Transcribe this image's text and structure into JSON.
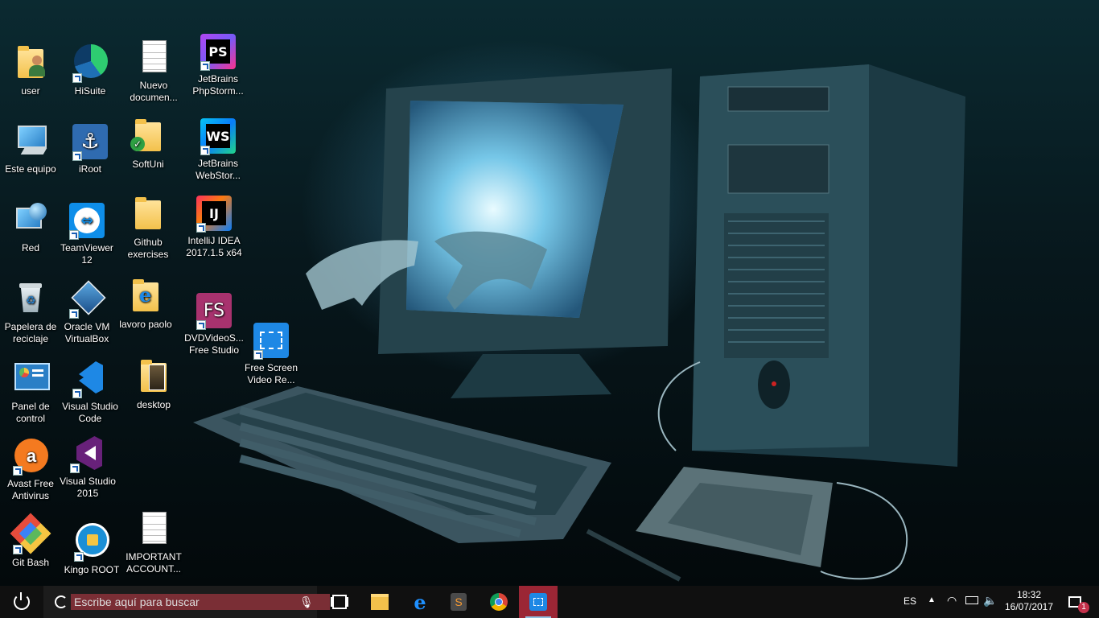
{
  "desktop": {
    "icons": [
      {
        "label": "user",
        "icon": "user-folder-icon"
      },
      {
        "label": "HiSuite",
        "icon": "hisuite-icon"
      },
      {
        "label": "Nuevo documen...",
        "icon": "text-document-icon"
      },
      {
        "label": "JetBrains PhpStorm...",
        "icon": "phpstorm-icon"
      },
      {
        "label": "Este equipo",
        "icon": "computer-icon"
      },
      {
        "label": "iRoot",
        "icon": "iroot-icon"
      },
      {
        "label": "SoftUni",
        "icon": "synced-folder-icon"
      },
      {
        "label": "JetBrains WebStor...",
        "icon": "webstorm-icon"
      },
      {
        "label": "Red",
        "icon": "network-icon"
      },
      {
        "label": "TeamViewer 12",
        "icon": "teamviewer-icon"
      },
      {
        "label": "Github exercises",
        "icon": "folder-icon"
      },
      {
        "label": "IntelliJ IDEA 2017.1.5 x64",
        "icon": "intellij-icon"
      },
      {
        "label": "Papelera de reciclaje",
        "icon": "recycle-bin-icon"
      },
      {
        "label": "Oracle VM VirtualBox",
        "icon": "virtualbox-icon"
      },
      {
        "label": "lavoro paolo",
        "icon": "ie-folder-icon"
      },
      {
        "label": "DVDVideoS... Free Studio",
        "icon": "dvdvideosoft-icon"
      },
      {
        "label": "Free Screen Video Re...",
        "icon": "screen-recorder-icon"
      },
      {
        "label": "Panel de control",
        "icon": "control-panel-icon"
      },
      {
        "label": "Visual Studio Code",
        "icon": "vscode-icon"
      },
      {
        "label": "desktop",
        "icon": "image-folder-icon"
      },
      {
        "label": "Avast Free Antivirus",
        "icon": "avast-icon"
      },
      {
        "label": "Visual Studio 2015",
        "icon": "visual-studio-icon"
      },
      {
        "label": "Git Bash",
        "icon": "git-bash-icon"
      },
      {
        "label": "Kingo ROOT",
        "icon": "kingo-root-icon"
      },
      {
        "label": "IMPORTANT ACCOUNT...",
        "icon": "text-document-icon"
      }
    ]
  },
  "taskbar": {
    "search_placeholder": "Escribe aquí para buscar",
    "pinned": [
      "task-view-icon",
      "file-explorer-icon",
      "edge-icon",
      "sublime-text-icon",
      "chrome-icon",
      "screen-recorder-icon"
    ],
    "tray": {
      "language": "ES",
      "time": "18:32",
      "date": "16/07/2017",
      "notification_count": "1"
    }
  },
  "colors": {
    "taskbar": "#101010",
    "search_box": "#7a2e35",
    "active_app": "#9b2635"
  }
}
